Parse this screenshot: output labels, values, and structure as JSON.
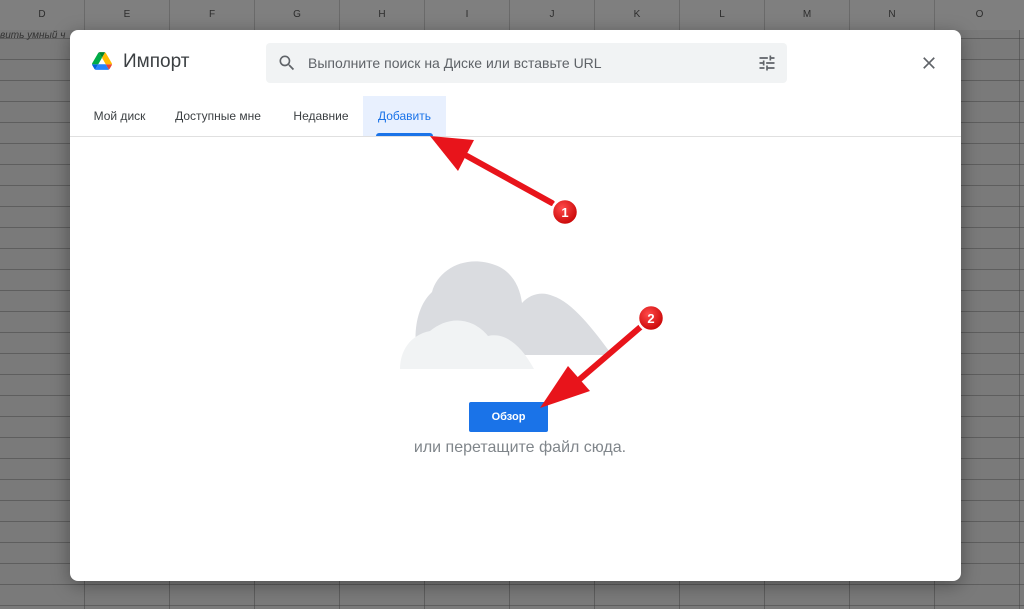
{
  "spreadsheet": {
    "columns": [
      "D",
      "E",
      "F",
      "G",
      "H",
      "I",
      "J",
      "K",
      "L",
      "M",
      "N",
      "O"
    ],
    "cell_text": "вить умный ч"
  },
  "dialog": {
    "title": "Импорт",
    "search": {
      "placeholder": "Выполните поиск на Диске или вставьте URL"
    },
    "tabs": [
      {
        "label": "Мой диск"
      },
      {
        "label": "Доступные мне"
      },
      {
        "label": "Недавние"
      },
      {
        "label": "Добавить",
        "active": true
      }
    ],
    "upload": {
      "button_label": "Обзор",
      "hint": "или перетащите файл сюда."
    }
  },
  "annotations": {
    "badges": [
      "1",
      "2"
    ],
    "arrow_color": "#e8141b"
  },
  "colors": {
    "accent": "#1a73e8",
    "active_tab_bg": "#e8f0fe",
    "cloud": "#dadce0"
  }
}
